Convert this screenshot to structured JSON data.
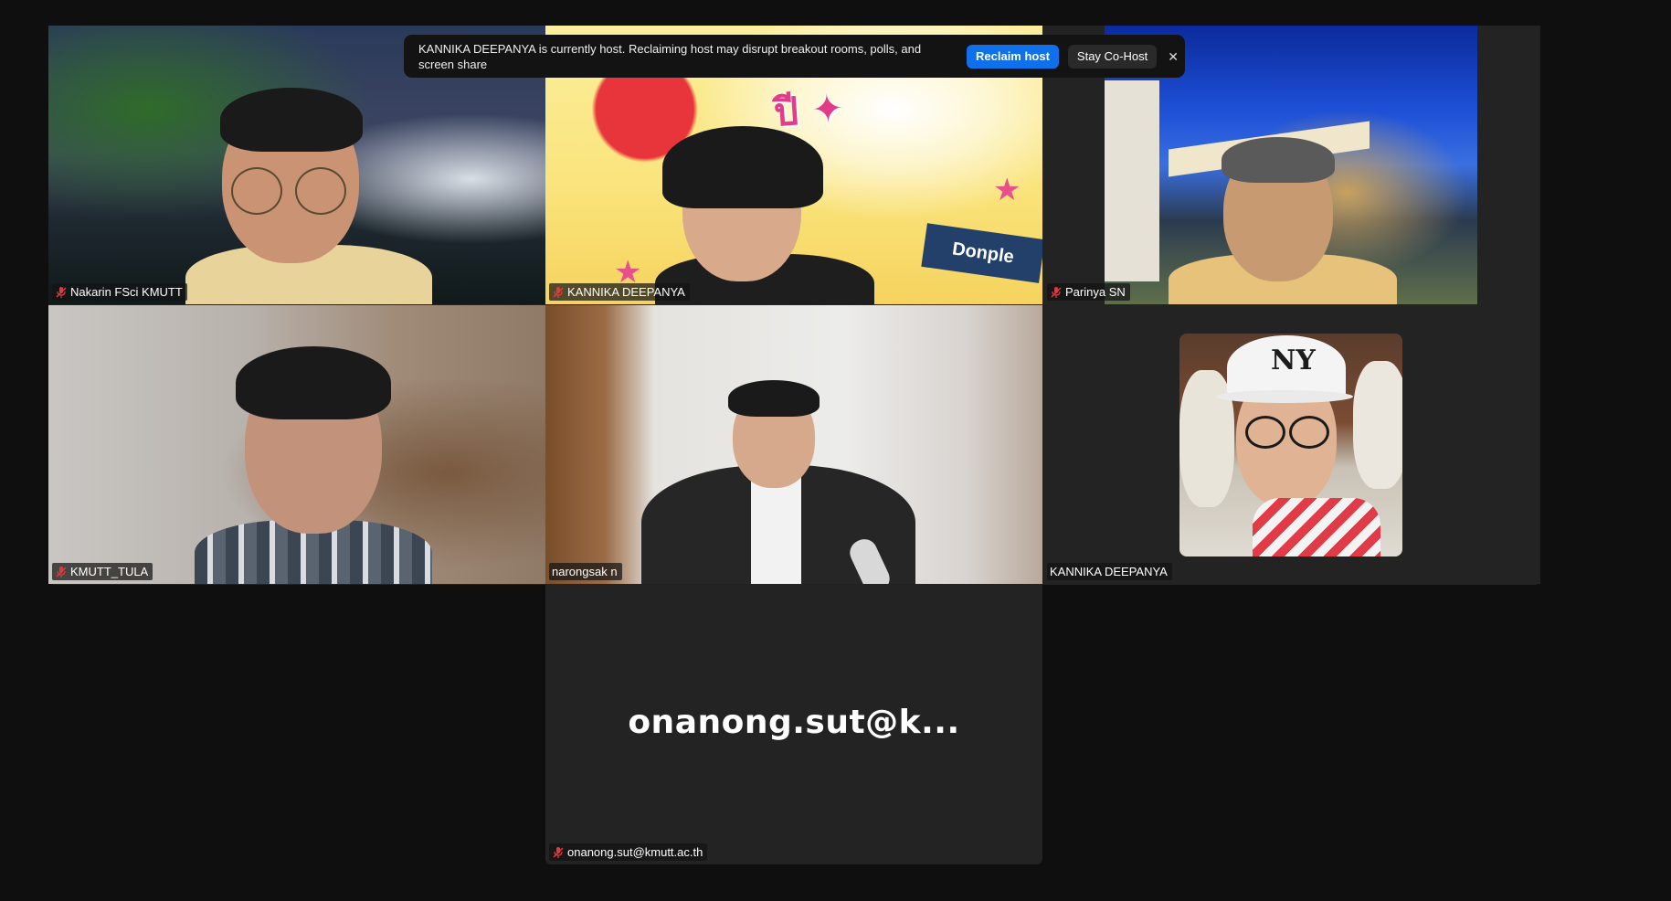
{
  "banner": {
    "message": "KANNIKA DEEPANYA is currently host. Reclaiming host may disrupt breakout rooms, polls, and screen share",
    "reclaim_label": "Reclaim host",
    "stay_label": "Stay Co-Host",
    "close_label": "✕"
  },
  "participants": [
    {
      "name": "Nakarin FSci KMUTT",
      "muted": true
    },
    {
      "name": "KANNIKA DEEPANYA",
      "muted": true
    },
    {
      "name": "Parinya SN",
      "muted": true
    },
    {
      "name": "KMUTT_TULA",
      "muted": true
    },
    {
      "name": "narongsak n",
      "muted": false,
      "active_speaker": true
    },
    {
      "name": "KANNIKA DEEPANYA",
      "muted": false,
      "video_off": true
    },
    {
      "name": "onanong.sut@kmutt.ac.th",
      "display_short": "onanong.sut@k...",
      "muted": true,
      "video_off": true
    }
  ],
  "backgrounds": {
    "comic_sign": "Donple",
    "cap_logo": "NY"
  },
  "colors": {
    "active_speaker_border": "#23d959",
    "primary_button": "#0e71eb",
    "muted_icon": "#e0393e",
    "tile_bg": "#232323",
    "page_bg": "#0f0f0f"
  }
}
